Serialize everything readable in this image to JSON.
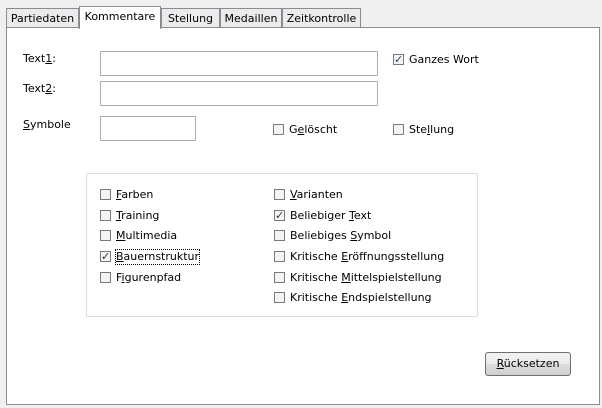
{
  "tabs": [
    {
      "label": "Partiedaten",
      "active": false
    },
    {
      "label": "Kommentare",
      "active": true
    },
    {
      "label": "Stellung",
      "active": false
    },
    {
      "label": "Medaillen",
      "active": false
    },
    {
      "label": "Zeitkontrolle",
      "active": false
    }
  ],
  "fields": {
    "text1": {
      "label_pre": "Text",
      "label_u": "1",
      "label_post": ":",
      "value": ""
    },
    "text2": {
      "label_pre": "Text",
      "label_u": "2",
      "label_post": ":",
      "value": ""
    },
    "symbole": {
      "label_pre": "",
      "label_u": "S",
      "label_post": "ymbole",
      "value": ""
    }
  },
  "options": {
    "ganzes_wort": {
      "label": "Ganzes Wort",
      "checked": true
    },
    "geloescht": {
      "label_pre": "G",
      "label_u": "e",
      "label_post": "löscht",
      "checked": false
    },
    "stellung": {
      "label_pre": "Ste",
      "label_u": "l",
      "label_post": "lung",
      "checked": false
    }
  },
  "group_left": [
    {
      "pre": "",
      "u": "F",
      "post": "arben",
      "checked": false
    },
    {
      "pre": "",
      "u": "T",
      "post": "raining",
      "checked": false
    },
    {
      "pre": "",
      "u": "M",
      "post": "ultimedia",
      "checked": false
    },
    {
      "pre": "",
      "u": "B",
      "post": "auernstruktur",
      "checked": true,
      "focused": true
    },
    {
      "pre": "F",
      "u": "i",
      "post": "gurenpfad",
      "checked": false
    }
  ],
  "group_right": [
    {
      "pre": "",
      "u": "V",
      "post": "arianten",
      "checked": false
    },
    {
      "pre": "Beliebiger ",
      "u": "T",
      "post": "ext",
      "checked": true
    },
    {
      "pre": "Beliebiges ",
      "u": "S",
      "post": "ymbol",
      "checked": false
    },
    {
      "pre": "Kritische ",
      "u": "E",
      "post": "röffnungsstellung",
      "checked": false
    },
    {
      "pre": "Kritische ",
      "u": "M",
      "post": "ittelspielstellung",
      "checked": false
    },
    {
      "pre": "Kritische ",
      "u": "E",
      "post": "ndspielstellung",
      "checked": false
    }
  ],
  "reset_button": {
    "pre": "",
    "u": "R",
    "post": "ücksetzen"
  },
  "colors": {
    "check": "#1e395b",
    "border": "#898c95"
  }
}
